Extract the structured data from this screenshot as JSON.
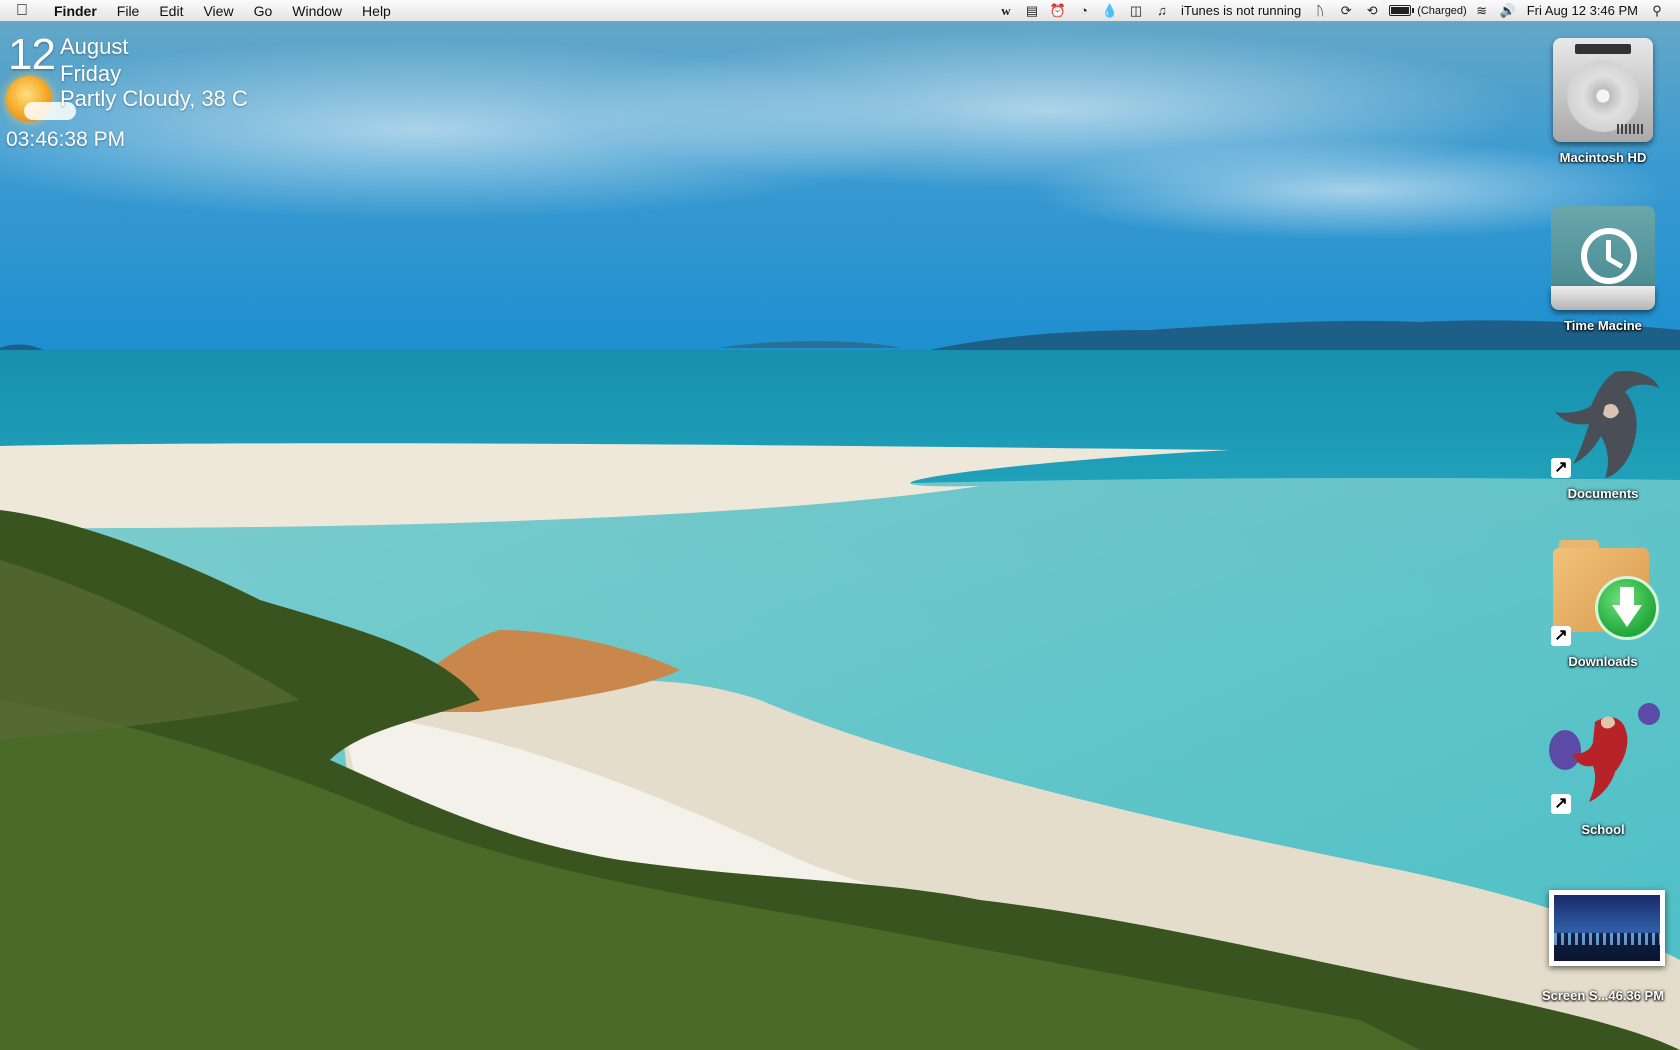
{
  "menubar": {
    "app_name": "Finder",
    "menus": [
      "File",
      "Edit",
      "View",
      "Go",
      "Window",
      "Help"
    ],
    "status_icons": [
      "wordpress-icon",
      "terminal-icon",
      "alarm-icon",
      "loading-icon",
      "drop-icon",
      "trash-icon",
      "itunes-icon"
    ],
    "itunes_status": "iTunes is not running",
    "battery_status": "(Charged)",
    "datetime": "Fri Aug 12  3:46 PM"
  },
  "widget": {
    "day": "12",
    "month": "August",
    "weekday": "Friday",
    "condition": "Partly Cloudy, 38 C",
    "time": "03:46:38 PM"
  },
  "desktop_icons": [
    {
      "label": "Macintosh HD",
      "icon": "hard-drive-icon"
    },
    {
      "label": "Time Macine",
      "icon": "time-machine-drive-icon"
    },
    {
      "label": "Documents",
      "icon": "documents-alias-icon"
    },
    {
      "label": "Downloads",
      "icon": "downloads-folder-icon"
    },
    {
      "label": "School",
      "icon": "school-alias-icon"
    },
    {
      "label": "Screen S...46.36 PM",
      "icon": "screenshot-thumbnail-icon"
    }
  ],
  "colors": {
    "sky": "#2f95cf",
    "sea": "#2bb8c4",
    "sand": "#eee6d6",
    "bush": "#3d5a1f"
  }
}
